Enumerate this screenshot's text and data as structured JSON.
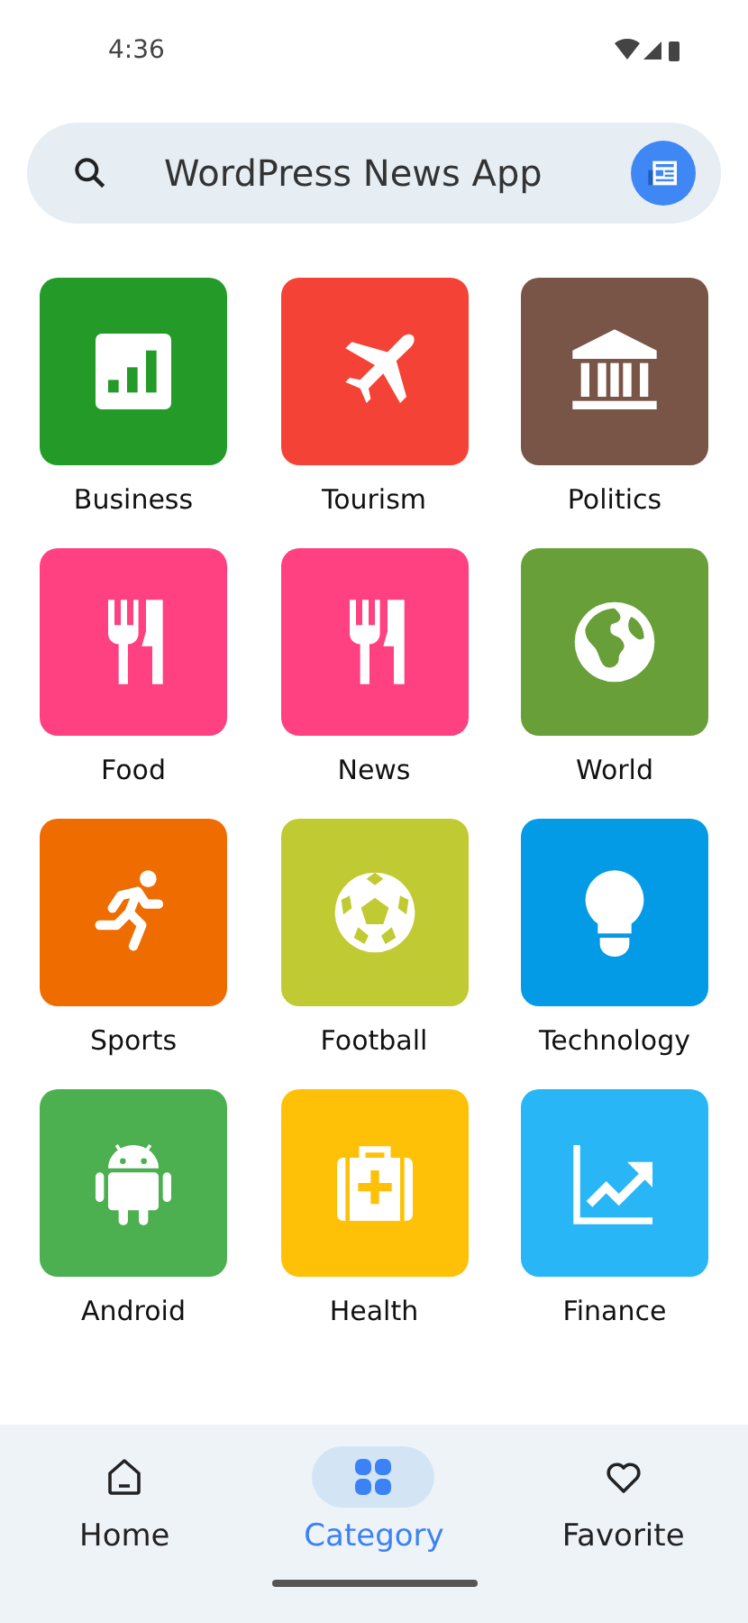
{
  "status_bar": {
    "time": "4:36"
  },
  "search_bar": {
    "title": "WordPress News App"
  },
  "categories": [
    {
      "label": "Business",
      "kind": "chart",
      "color": "#249a29"
    },
    {
      "label": "Tourism",
      "kind": "plane",
      "color": "#f44336"
    },
    {
      "label": "Politics",
      "kind": "bank",
      "color": "#795548"
    },
    {
      "label": "Food",
      "kind": "cutlery",
      "color": "#ff4081"
    },
    {
      "label": "News",
      "kind": "cutlery",
      "color": "#ff4081"
    },
    {
      "label": "World",
      "kind": "globe",
      "color": "#689f38"
    },
    {
      "label": "Sports",
      "kind": "runner",
      "color": "#ef6c00"
    },
    {
      "label": "Football",
      "kind": "ball",
      "color": "#c0ca33"
    },
    {
      "label": "Technology",
      "kind": "bulb",
      "color": "#039be5"
    },
    {
      "label": "Android",
      "kind": "android",
      "color": "#4caf50"
    },
    {
      "label": "Health",
      "kind": "medkit",
      "color": "#ffc107"
    },
    {
      "label": "Finance",
      "kind": "trend",
      "color": "#29b6f6"
    }
  ],
  "nav": [
    {
      "label": "Home",
      "kind": "home",
      "selected": false
    },
    {
      "label": "Category",
      "kind": "grid",
      "selected": true
    },
    {
      "label": "Favorite",
      "kind": "heart",
      "selected": false
    }
  ]
}
